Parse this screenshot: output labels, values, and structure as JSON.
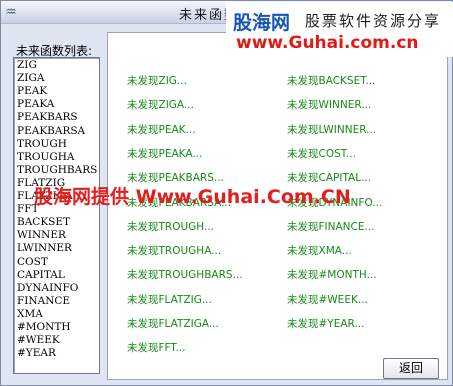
{
  "window": {
    "title": "未来函数"
  },
  "watermark": {
    "logo": "股海网",
    "slogan": "股票软件资源分享",
    "url": "www.Guhai.com.cn",
    "overlay": "股海网提供 Www.Guhai.Com.CN"
  },
  "list": {
    "caption": "未来函数列表:",
    "items": [
      "ZIG",
      "ZIGA",
      "PEAK",
      "PEAKA",
      "PEAKBARS",
      "PEAKBARSA",
      "TROUGH",
      "TROUGHA",
      "TROUGHBARS",
      "FLATZIG",
      "FLATZIGA",
      "FFT",
      "BACKSET",
      "WINNER",
      "LWINNER",
      "COST",
      "CAPITAL",
      "DYNAINFO",
      "FINANCE",
      "XMA",
      "#MONTH",
      "#WEEK",
      "#YEAR"
    ]
  },
  "results": {
    "col1": [
      "未发现ZIG...",
      "未发现ZIGA...",
      "未发现PEAK...",
      "未发现PEAKA...",
      "未发现PEAKBARS...",
      "未发现PEAKBARSA...",
      "未发现TROUGH...",
      "未发现TROUGHA...",
      "未发现TROUGHBARS...",
      "未发现FLATZIG...",
      "未发现FLATZIGA...",
      "未发现FFT..."
    ],
    "col2": [
      "未发现BACKSET...",
      "未发现WINNER...",
      "未发现LWINNER...",
      "未发现COST...",
      "未发现CAPITAL...",
      "未发现DYNAINFO...",
      "未发现FINANCE...",
      "未发现XMA...",
      "未发现#MONTH...",
      "未发现#WEEK...",
      "未发现#YEAR..."
    ]
  },
  "buttons": {
    "back": "返回"
  }
}
